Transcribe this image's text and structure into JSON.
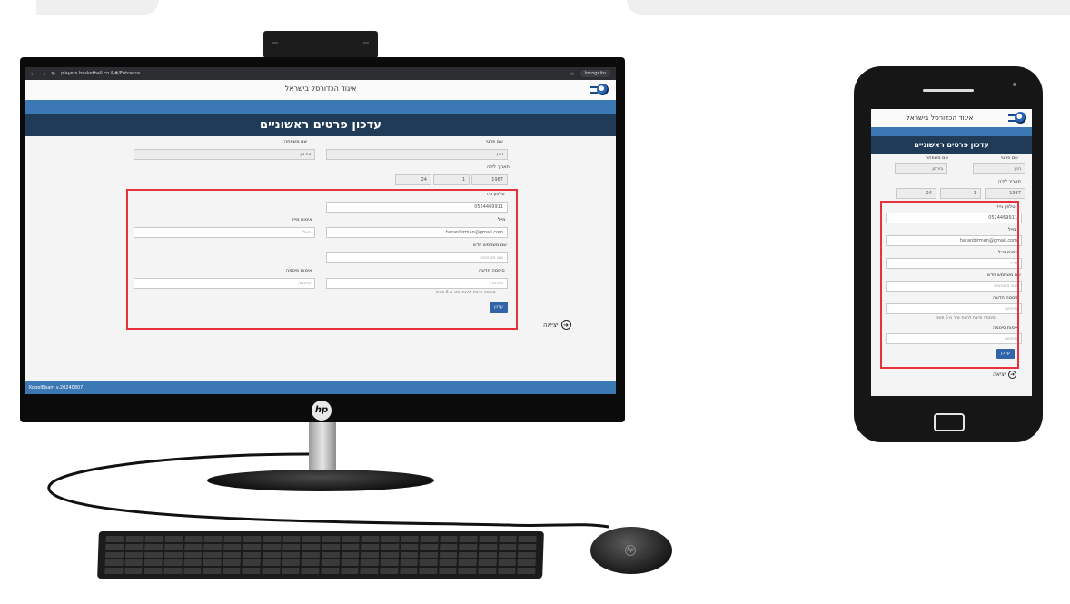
{
  "browser": {
    "url": "players.basketball.co.il/#/Entrance",
    "incognito_label": "Incognito"
  },
  "site": {
    "title": "איגוד הכדורסל בישראל",
    "page_heading": "עדכון פרטים ראשוניים",
    "footer": "KopelBeam v.20240807"
  },
  "form": {
    "first_name_label": "שם פרטי",
    "first_name_value": "הרן",
    "last_name_label": "שם משפחה",
    "last_name_value": "בירמן",
    "dob_label": "תאריך לידה",
    "dob_year": "1987",
    "dob_month": "1",
    "dob_day": "24",
    "mobile_label": "טלפון נייד",
    "mobile_value": "0524469911",
    "email_label": "מייל",
    "email_value": "haranbirman@gmail.com",
    "email_confirm_label": "אימות מייל",
    "email_confirm_placeholder": "מייל",
    "username_label": "שם משתמש חדש",
    "username_placeholder": "שם משתמש",
    "password_label": "סיסמה חדשה",
    "password_placeholder": "סיסמה",
    "password_confirm_label": "אימות סיסמה",
    "password_confirm_placeholder": "סיסמה",
    "password_hint": "סיסמה חייבת להיות יותר מ 6 תווים",
    "update_button": "עדכן",
    "exit_label": "יציאה"
  },
  "device_brand": "hp",
  "colors": {
    "header_dark": "#1f3b58",
    "accent_blue": "#3c78b4",
    "highlight_red": "#e5323c"
  }
}
